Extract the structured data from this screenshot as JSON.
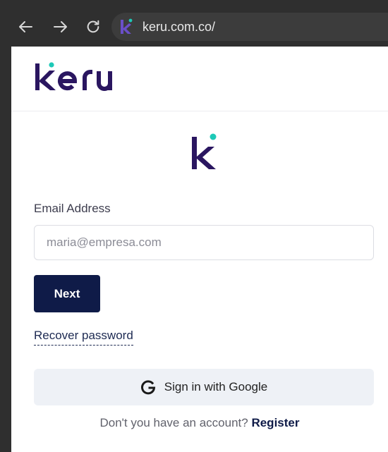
{
  "browser": {
    "url": "keru.com.co/",
    "icons": [
      "back-arrow-icon",
      "forward-arrow-icon",
      "reload-icon",
      "keru-favicon"
    ]
  },
  "header": {
    "logo_text": "keru"
  },
  "login": {
    "email_label": "Email Address",
    "email_placeholder": "maria@empresa.com",
    "email_value": "",
    "next_label": "Next",
    "recover_label": "Recover password",
    "google_label": "Sign in with Google",
    "no_account_text": "Don't you have an account?",
    "register_label": "Register"
  },
  "colors": {
    "brand_navy": "#0f1b48",
    "brand_purple": "#2a1660",
    "brand_accent": "#1ec9b7",
    "button_bg": "#0f1b48",
    "google_button_bg": "#eef1f6",
    "browser_chrome": "#2f2f2f"
  }
}
